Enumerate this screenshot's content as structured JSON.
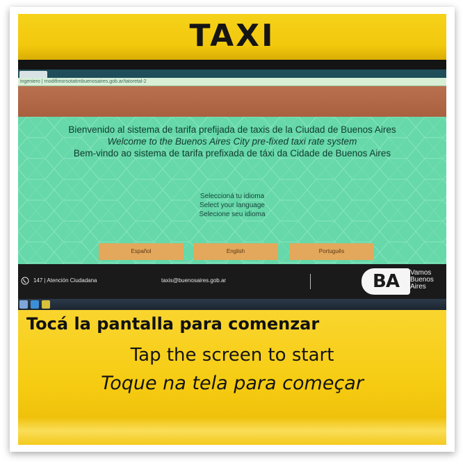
{
  "sign": {
    "title": "TAXI"
  },
  "browser": {
    "url": "ingeniero | rnodifimorsotatimbuenosaires.gob.ar/tatoretal-2"
  },
  "welcome": {
    "es": "Bienvenido al sistema de tarifa prefijada de taxis de la Ciudad de Buenos Aires",
    "en": "Welcome to the Buenos Aires City pre-fixed taxi rate system",
    "pt": "Bem-vindo ao sistema de tarifa prefixada de táxi da Cidade de Buenos Aires"
  },
  "select_language": {
    "es": "Seleccioná tu idioma",
    "en": "Select your language",
    "pt": "Selecione seu idioma"
  },
  "language_buttons": {
    "es": "Español",
    "en": "English",
    "pt": "Português"
  },
  "footer": {
    "phone": "147 | Atención Ciudadana",
    "email": "taxis@buenosaires.gob.ar",
    "logo": "BA",
    "tagline": [
      "Vamos",
      "Buenos",
      "Aires"
    ]
  },
  "sticker": {
    "es": "Tocá la pantalla para comenzar",
    "en": "Tap the screen to start",
    "pt": "Toque na tela para começar"
  },
  "colors": {
    "taxi_yellow": "#f2c80c",
    "screen_green": "#66d8a9",
    "header_brown": "#b9704e",
    "button_orange": "#e3a85b",
    "footer_dark": "#1a1a1a"
  },
  "icons": [
    "phone-icon"
  ]
}
